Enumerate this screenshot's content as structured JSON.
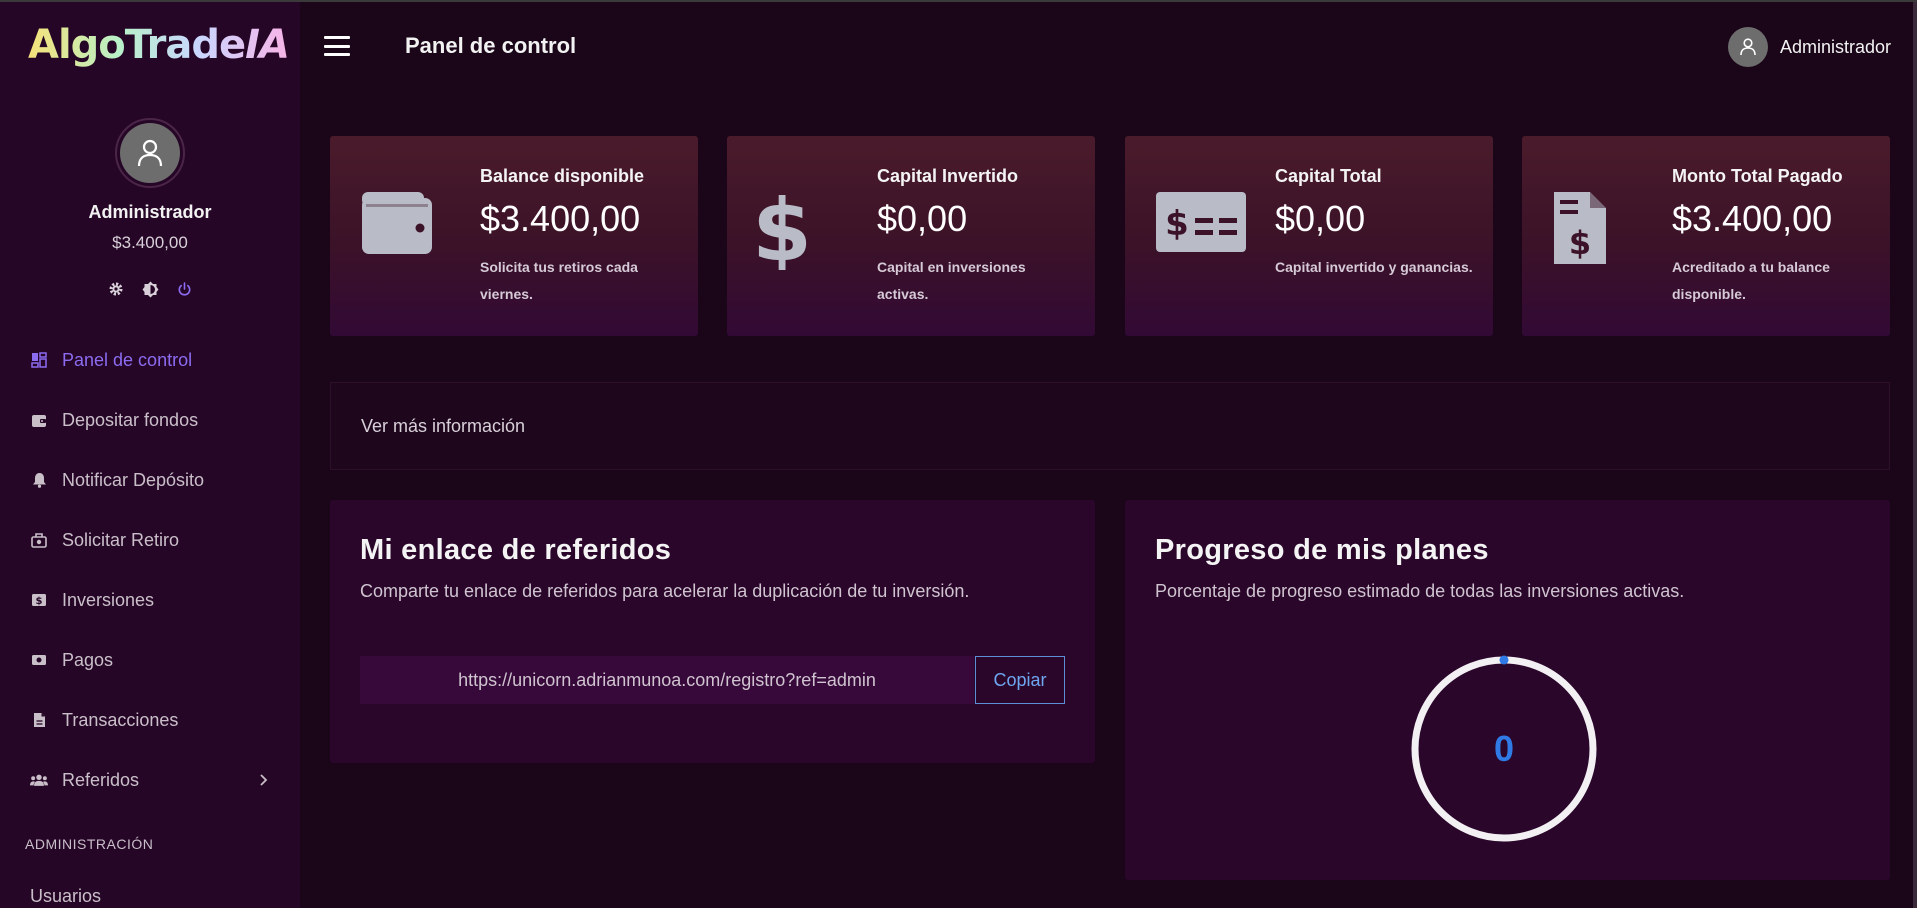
{
  "brand": {
    "logo_main": "AlgoTrade",
    "logo_suffix": "IA"
  },
  "header": {
    "title": "Panel de control",
    "user_name": "Administrador"
  },
  "sidebar": {
    "user_name": "Administrador",
    "user_balance": "$3.400,00",
    "actions": [
      "gear-icon",
      "brightness-icon",
      "power-icon"
    ],
    "items": [
      {
        "label": "Panel de control",
        "icon": "dashboard-icon",
        "active": true
      },
      {
        "label": "Depositar fondos",
        "icon": "wallet-icon"
      },
      {
        "label": "Notificar Depósito",
        "icon": "bell-icon"
      },
      {
        "label": "Solicitar Retiro",
        "icon": "money-bag-icon"
      },
      {
        "label": "Inversiones",
        "icon": "dollar-square-icon"
      },
      {
        "label": "Pagos",
        "icon": "banknote-icon"
      },
      {
        "label": "Transacciones",
        "icon": "document-icon"
      },
      {
        "label": "Referidos",
        "icon": "users-icon",
        "has_submenu": true
      }
    ],
    "section_label": "ADMINISTRACIÓN",
    "next_item_label": "Usuarios"
  },
  "stats": [
    {
      "label": "Balance disponible",
      "value": "$3.400,00",
      "note": "Solicita tus retiros cada viernes.",
      "icon": "wallet-icon"
    },
    {
      "label": "Capital Invertido",
      "value": "$0,00",
      "note": "Capital en inversiones activas.",
      "icon": "dollar-sign-icon"
    },
    {
      "label": "Capital Total",
      "value": "$0,00",
      "note": "Capital invertido y ganancias.",
      "icon": "money-bill-icon"
    },
    {
      "label": "Monto Total Pagado",
      "value": "$3.400,00",
      "note": "Acreditado a tu balance disponible.",
      "icon": "invoice-dollar-icon"
    }
  ],
  "info_bar": {
    "label": "Ver más información"
  },
  "referral": {
    "title": "Mi enlace de referidos",
    "subtitle": "Comparte tu enlace de referidos para acelerar la duplicación de tu inversión.",
    "link_value": "https://unicorn.adrianmunoa.com/registro?ref=admin",
    "copy_label": "Copiar"
  },
  "progress": {
    "title": "Progreso de mis planes",
    "subtitle": "Porcentaje de progreso estimado de todas las inversiones activas.",
    "value": "0",
    "percent": 0
  },
  "colors": {
    "accent": "#8b6cf0",
    "progress": "#2f7ae5",
    "sidebar_bg": "#260626",
    "page_bg": "#1a0519"
  }
}
